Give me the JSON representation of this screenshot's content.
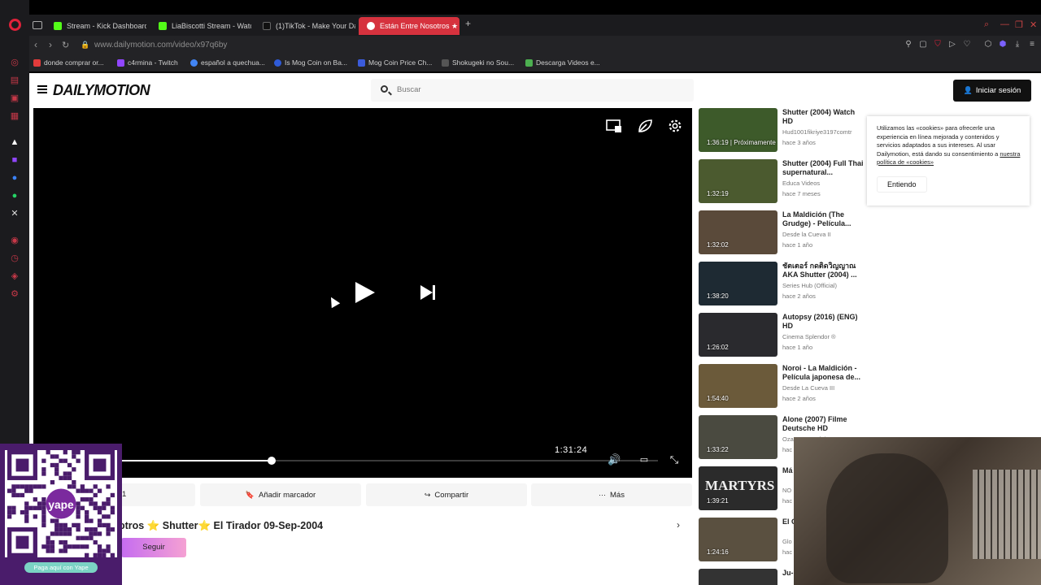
{
  "browser": {
    "tabs": [
      {
        "title": "Stream - Kick Dashboard",
        "fav": "#53fc18"
      },
      {
        "title": "LiaBiscotti Stream - Watc",
        "fav": "#53fc18"
      },
      {
        "title": "(1)TikTok - Make Your Da",
        "fav": "#111111"
      },
      {
        "title": "Están Entre Nosotros ★ Sh",
        "fav": "#ffffff"
      }
    ],
    "url": "www.dailymotion.com/video/x97q6by",
    "bookmarks": [
      {
        "label": "donde comprar or...",
        "fav": "#e23b3b"
      },
      {
        "label": "c4rmina - Twitch",
        "fav": "#9146ff"
      },
      {
        "label": "español a quechua...",
        "fav": "#4285f4"
      },
      {
        "label": "Is Mog Coin on Ba...",
        "fav": "#2f5bd8"
      },
      {
        "label": "Mog Coin Price Ch...",
        "fav": "#3b5bdb"
      },
      {
        "label": "Shokugeki no Sou...",
        "fav": "#333333"
      },
      {
        "label": "Descarga Videos e...",
        "fav": "#4caf50"
      }
    ]
  },
  "site": {
    "brand": "DAILYMOTION",
    "search_placeholder": "Buscar",
    "login_label": "Iniciar sesión"
  },
  "player": {
    "duration": "1:31:24",
    "progress": 0.28
  },
  "actions": {
    "first_label": "1",
    "bookmark_label": "Añadir marcador",
    "share_label": "Compartir",
    "more_label": "Más"
  },
  "video": {
    "title": "otros ⭐ Shutter⭐ El Tirador 09-Sep-2004",
    "follow_label": "Seguir"
  },
  "cookie": {
    "text": "Utilizamos las «cookies» para ofrecerle una experiencia en línea mejorada y contenidos y servicios adaptados a sus intereses. Al usar Dailymotion, está dando su consentimiento a",
    "link": "nuestra política de «cookies»",
    "button": "Entiendo"
  },
  "related": [
    {
      "title": "Shutter (2004) Watch HD",
      "channel": "Hud1001fikriye3197comtr",
      "age": "hace 3 años",
      "duration": "1:36:19",
      "badge": "Próximamente",
      "color": "#3d5a2a"
    },
    {
      "title": "Shutter (2004) Full Thai supernatural...",
      "channel": "Educa Videos",
      "age": "hace 7 meses",
      "duration": "1:32:19",
      "badge": "",
      "color": "#4b5a2f"
    },
    {
      "title": "La Maldición (The Grudge) - Película...",
      "channel": "Desde la Cueva II",
      "age": "hace 1 año",
      "duration": "1:32:02",
      "badge": "",
      "color": "#5a4a3a"
    },
    {
      "title": "ชัตเตอร์ กดติดวิญญาณ AKA Shutter (2004) ...",
      "channel": "Series Hub (Official)",
      "age": "hace 2 años",
      "duration": "1:38:20",
      "badge": "",
      "color": "#1e2a33"
    },
    {
      "title": "Autopsy (2016) (ENG) HD",
      "channel": "Cinema Splendor ®",
      "age": "hace 1 año",
      "duration": "1:26:02",
      "badge": "",
      "color": "#2a2a2e"
    },
    {
      "title": "Noroi - La Maldición - Película japonesa de...",
      "channel": "Desde La Cueva III",
      "age": "hace 2 años",
      "duration": "1:54:40",
      "badge": "",
      "color": "#6b5a3a"
    },
    {
      "title": "Alone (2007) Filme Deutsche HD",
      "channel": "Ozan2542muftdat3456c",
      "age": "hac",
      "duration": "1:33:22",
      "badge": "",
      "color": "#4a4a40"
    },
    {
      "title": "Má",
      "channel": "NO",
      "age": "hac",
      "duration": "1:39:21",
      "badge": "",
      "color": "#2b2b2b",
      "thumb_text": "MARTYRS"
    },
    {
      "title": "El C Lat",
      "channel": "Glo",
      "age": "hac",
      "duration": "1:24:16",
      "badge": "",
      "color": "#5a5040"
    },
    {
      "title": "Ju-",
      "channel": "",
      "age": "",
      "duration": "",
      "badge": "",
      "color": "#333333"
    }
  ],
  "overlay": {
    "qr_label": "Paga aquí con Yape",
    "qr_brand": "yape"
  }
}
